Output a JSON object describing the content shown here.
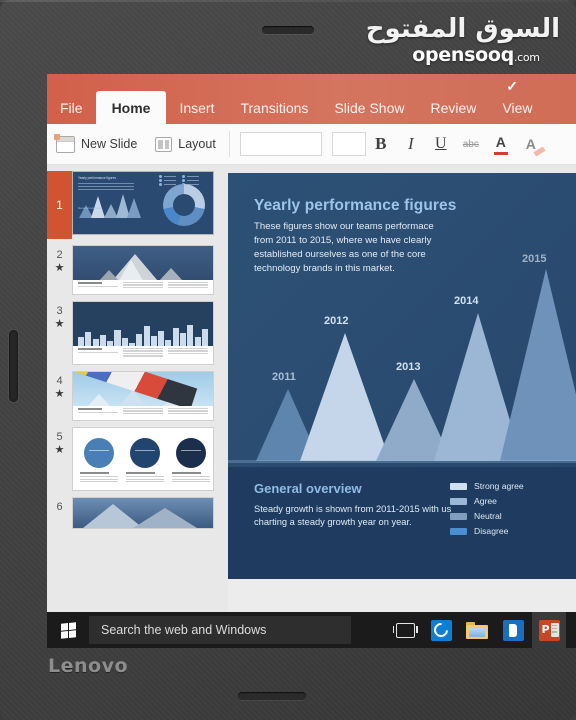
{
  "watermark": {
    "arabic": "السوق المفتوح",
    "english": "opensooq",
    "tld": ".com"
  },
  "device": {
    "brand": "Lenovo"
  },
  "app": {
    "ribbon": {
      "tabs": [
        {
          "label": "File",
          "active": false
        },
        {
          "label": "Home",
          "active": true
        },
        {
          "label": "Insert",
          "active": false
        },
        {
          "label": "Transitions",
          "active": false
        },
        {
          "label": "Slide Show",
          "active": false
        },
        {
          "label": "Review",
          "active": false
        },
        {
          "label": "View",
          "active": false
        }
      ],
      "accent_color": "#d2604a",
      "check_icon": "✓"
    },
    "toolbar": {
      "new_slide_label": "New Slide",
      "layout_label": "Layout",
      "font_name_value": "",
      "font_size_value": "",
      "bold_label": "B",
      "italic_label": "I",
      "underline_label": "U",
      "strikethrough_label": "abc",
      "font_color_label": "A",
      "text_highlight_label": "A",
      "font_color_swatch": "#d0402c"
    }
  },
  "thumbnails": [
    {
      "number": "1",
      "starred": false,
      "selected": true,
      "kind": "peaks-donut"
    },
    {
      "number": "2",
      "starred": true,
      "selected": false,
      "kind": "mountain-photo"
    },
    {
      "number": "3",
      "starred": true,
      "selected": false,
      "kind": "bar-chart"
    },
    {
      "number": "4",
      "starred": true,
      "selected": false,
      "kind": "flags-photo"
    },
    {
      "number": "5",
      "starred": true,
      "selected": false,
      "kind": "three-circles"
    },
    {
      "number": "6",
      "starred": false,
      "selected": false,
      "kind": "photo"
    }
  ],
  "slide": {
    "title": "Yearly performance figures",
    "body": "These figures show our teams performace from 2011 to 2015, where we have clearly established ourselves as one of the core technology brands in this market.",
    "panel": {
      "title": "General overview",
      "body": "Steady growth is shown from 2011-2015 with us charting a steady growth year on year.",
      "legend": [
        {
          "label": "Strong agree",
          "color": "#cfe0f2"
        },
        {
          "label": "Agree",
          "color": "#9cb8d6"
        },
        {
          "label": "Neutral",
          "color": "#7f9ebd"
        },
        {
          "label": "Disagree",
          "color": "#4a8fd0"
        }
      ]
    }
  },
  "chart_data": {
    "type": "area",
    "title": "Yearly performance figures",
    "categories": [
      "2011",
      "2012",
      "2013",
      "2014",
      "2015"
    ],
    "values": [
      42,
      78,
      48,
      92,
      118
    ],
    "xlabel": "",
    "ylabel": "",
    "ylim": [
      0,
      130
    ],
    "grid": false,
    "legend": [
      "Strong agree",
      "Agree",
      "Neutral",
      "Disagree"
    ],
    "annotations": [
      "2011",
      "2012",
      "2013",
      "2014",
      "2015"
    ],
    "series": [
      {
        "name": "Yearly performance",
        "values": [
          42,
          78,
          48,
          92,
          118
        ]
      }
    ]
  },
  "taskbar": {
    "search_placeholder": "Search the web and Windows",
    "start_name": "windows-start",
    "icons": [
      {
        "name": "task-view-icon",
        "label": ""
      },
      {
        "name": "edge-icon",
        "label": ""
      },
      {
        "name": "file-explorer-icon",
        "label": ""
      },
      {
        "name": "office-icon",
        "label": ""
      },
      {
        "name": "powerpoint-icon",
        "label": "P"
      }
    ]
  }
}
